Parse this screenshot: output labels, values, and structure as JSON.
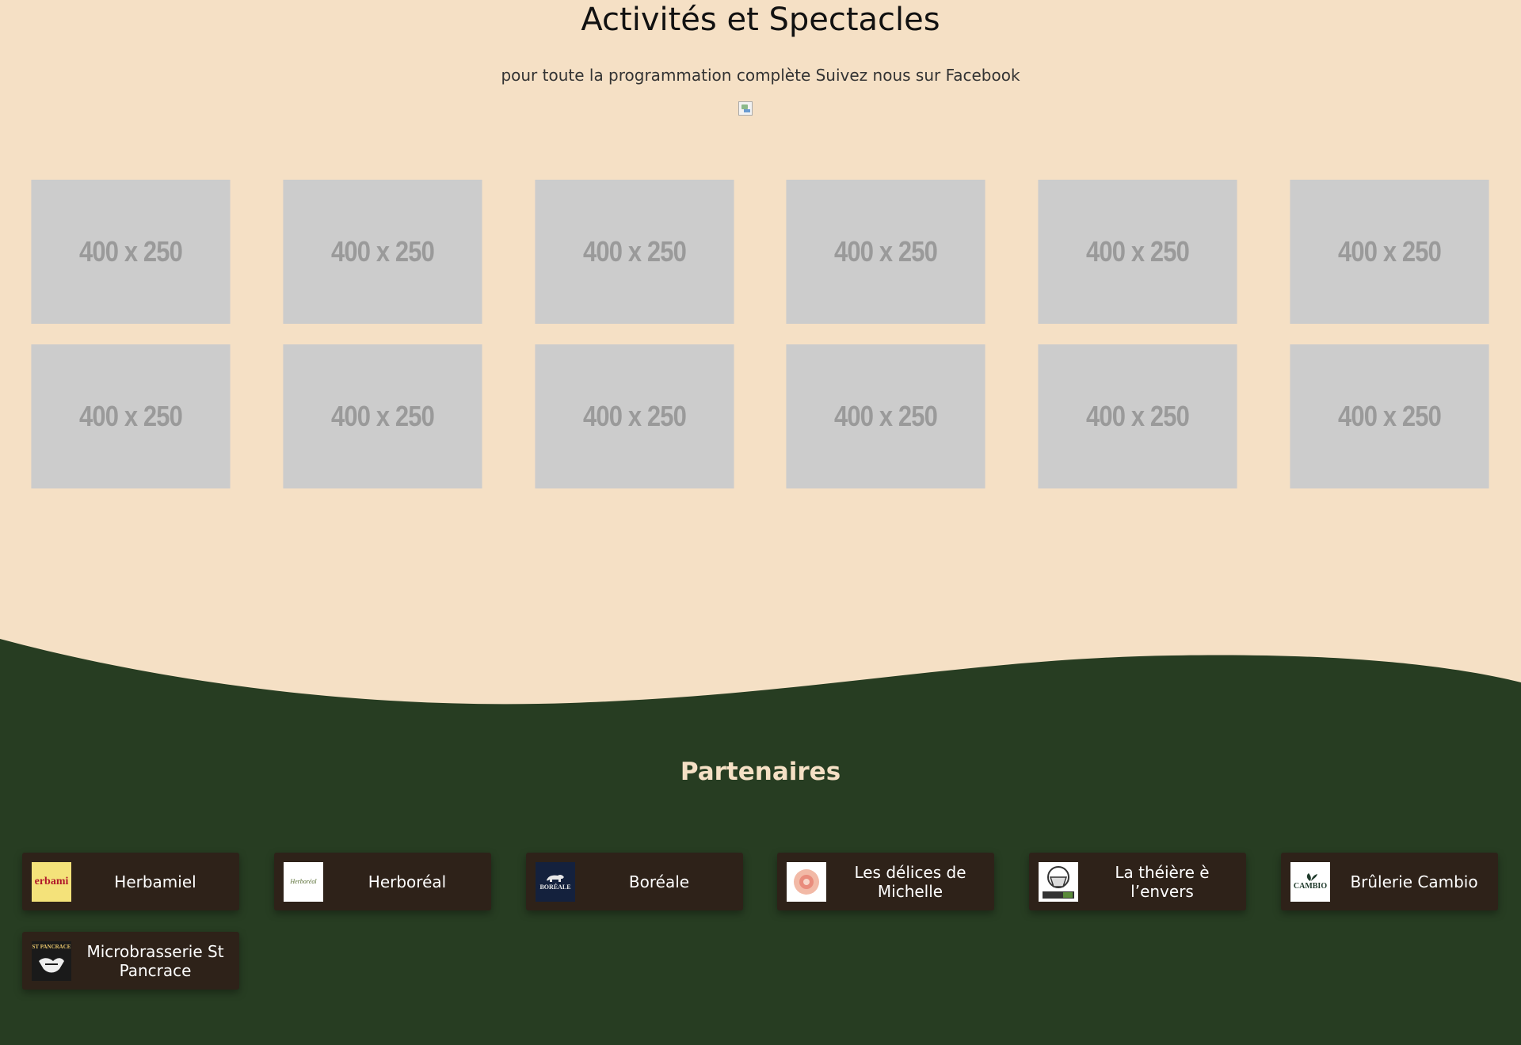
{
  "activities": {
    "title": "Activités et Spectacles",
    "subtitle_text": "pour toute la programmation complète Suivez nous sur ",
    "subtitle_link": "Facebook"
  },
  "gallery": {
    "tiles": [
      {
        "label": "400 x 250"
      },
      {
        "label": "400 x 250"
      },
      {
        "label": "400 x 250"
      },
      {
        "label": "400 x 250"
      },
      {
        "label": "400 x 250"
      },
      {
        "label": "400 x 250"
      },
      {
        "label": "400 x 250"
      },
      {
        "label": "400 x 250"
      },
      {
        "label": "400 x 250"
      },
      {
        "label": "400 x 250"
      },
      {
        "label": "400 x 250"
      },
      {
        "label": "400 x 250"
      }
    ]
  },
  "partners": {
    "title": "Partenaires",
    "items": [
      {
        "name": "Herbamiel",
        "logo_text": "erbami",
        "logo_icon": "herbamiel-logo-icon"
      },
      {
        "name": "Herboréal",
        "logo_text": "Herboréal",
        "logo_icon": "herboreal-logo-icon"
      },
      {
        "name": "Boréale",
        "logo_text": "BORÉALE",
        "logo_icon": "boreale-logo-icon"
      },
      {
        "name": "Les délices de Michelle",
        "logo_text": "",
        "logo_icon": "delices-michelle-logo-icon"
      },
      {
        "name": "La théière è l’envers",
        "logo_text": "",
        "logo_icon": "theiere-logo-icon"
      },
      {
        "name": "Brûlerie Cambio",
        "logo_text": "CAMBIO",
        "logo_icon": "cambio-logo-icon"
      },
      {
        "name": "Microbrasserie St Pancrace",
        "logo_text": "ST PANCRACE",
        "logo_icon": "st-pancrace-logo-icon"
      }
    ]
  },
  "colors": {
    "background": "#f5e0c5",
    "footer_green": "#273d22",
    "partner_card": "#2e2219",
    "placeholder": "#cccccc"
  }
}
